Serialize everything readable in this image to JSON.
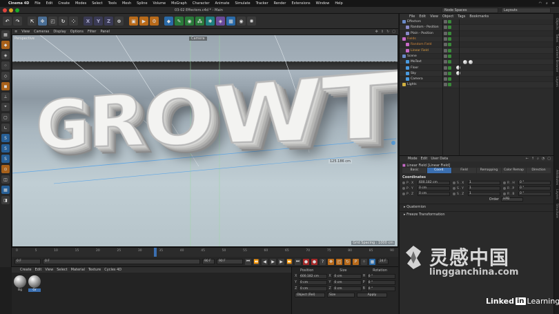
{
  "menubar": {
    "app": "Cinema 4D",
    "items": [
      "File",
      "Edit",
      "Create",
      "Modes",
      "Select",
      "Tools",
      "Mesh",
      "Spline",
      "Volume",
      "MoGraph",
      "Character",
      "Animate",
      "Simulate",
      "Tracker",
      "Render",
      "Extensions",
      "Window",
      "Help"
    ]
  },
  "window": {
    "title": "03-02 Effectors.c4d * - Main",
    "node_spaces": "Node Spaces",
    "layouts": "Layouts"
  },
  "toolbar": {
    "x": "X",
    "y": "Y",
    "z": "Z"
  },
  "viewport": {
    "menu": [
      "View",
      "Cameras",
      "Display",
      "Options",
      "Filter",
      "Panel"
    ],
    "label": "Perspective",
    "camera_label": "Camera",
    "text": "GROWTH",
    "dimension": "125.186 cm",
    "grid_spacing": "Grid Spacing : 1000 cm"
  },
  "timeline": {
    "ticks": [
      "0",
      "5",
      "10",
      "15",
      "20",
      "25",
      "30",
      "35",
      "40",
      "45",
      "50",
      "55",
      "60",
      "65",
      "70",
      "75",
      "80",
      "85",
      "90"
    ],
    "playhead": "24",
    "start": "0 F",
    "current": "0 F",
    "end": "90 F",
    "end2": "90 F",
    "frame": "24 F"
  },
  "material": {
    "menu": [
      "Create",
      "Edit",
      "View",
      "Select",
      "Material",
      "Texture",
      "Cycles 4D"
    ],
    "items": [
      {
        "label": "Bg",
        "selected": false
      },
      {
        "label": "Gr",
        "selected": true
      }
    ]
  },
  "coords": {
    "headers": [
      "Position",
      "Size",
      "Rotation"
    ],
    "rows": [
      {
        "a": "X",
        "av": "600.182 cm",
        "b": "X",
        "bv": "0 cm",
        "c": "H",
        "cv": "0 °"
      },
      {
        "a": "Y",
        "av": "0 cm",
        "b": "Y",
        "bv": "0 cm",
        "c": "P",
        "cv": "0 °"
      },
      {
        "a": "Z",
        "av": "0 cm",
        "b": "Z",
        "bv": "0 cm",
        "c": "B",
        "cv": "0 °"
      }
    ],
    "mode": "Object (Rel)",
    "size_mode": "Size",
    "apply": "Apply"
  },
  "object_manager": {
    "menu": [
      "File",
      "Edit",
      "View",
      "Object",
      "Tags",
      "Bookmarks"
    ],
    "objects": [
      {
        "name": "Effectors",
        "indent": 0,
        "color": "#6a8ac8"
      },
      {
        "name": "Random - Position",
        "indent": 1,
        "color": "#8a8ac8"
      },
      {
        "name": "Plain - Position",
        "indent": 1,
        "color": "#8a8ac8"
      },
      {
        "name": "Fields",
        "indent": 0,
        "color": "#c86ac8",
        "highlight": "#d58a3a"
      },
      {
        "name": "Random Field",
        "indent": 1,
        "color": "#c86ac8",
        "highlight": "#d58a3a"
      },
      {
        "name": "Linear Field",
        "indent": 1,
        "color": "#c86ac8",
        "highlight": "#e0a040"
      },
      {
        "name": "Scene",
        "indent": 0,
        "color": "#6a8ac8"
      },
      {
        "name": "MoText",
        "indent": 1,
        "color": "#4a9adf"
      },
      {
        "name": "Floor",
        "indent": 1,
        "color": "#4a9adf"
      },
      {
        "name": "Sky",
        "indent": 1,
        "color": "#4a9adf"
      },
      {
        "name": "Camera",
        "indent": 1,
        "color": "#4a9adf"
      },
      {
        "name": "Lights",
        "indent": 0,
        "color": "#d0b040"
      }
    ]
  },
  "attributes": {
    "menu": [
      "Mode",
      "Edit",
      "User Data"
    ],
    "title": "Linear Field [Linear Field]",
    "tabs": [
      {
        "label": "Basic",
        "active": false
      },
      {
        "label": "Coord.",
        "active": true
      },
      {
        "label": "Field",
        "active": false
      },
      {
        "label": "Remapping",
        "active": false
      },
      {
        "label": "Color Remap",
        "active": false
      },
      {
        "label": "Direction",
        "active": false
      }
    ],
    "section": "Coordinates",
    "rows": [
      {
        "a": "P . X",
        "av": "600.182 cm",
        "b": "S . X",
        "bv": "1",
        "c": "R . H",
        "cv": "0 °"
      },
      {
        "a": "P . Y",
        "av": "0 cm",
        "b": "S . Y",
        "bv": "1",
        "c": "R . P",
        "cv": "0 °"
      },
      {
        "a": "P . Z",
        "av": "0 cm",
        "b": "S . Z",
        "bv": "1",
        "c": "R . B",
        "cv": "0 °"
      }
    ],
    "order_label": "Order",
    "order_value": "HPB",
    "collapsed": [
      "Quaternion",
      "Freeze Transformation"
    ]
  },
  "right_strip": [
    "Objects",
    "Takes",
    "Content Browser",
    "Layers"
  ],
  "right_strip_lower": [
    "Attributes",
    "Layers",
    "Structure"
  ],
  "watermark": {
    "cn": "灵感中国",
    "url": "lingganchina.com",
    "linkedin_a": "Linked",
    "linkedin_in": "in",
    "linkedin_b": "Learning"
  }
}
